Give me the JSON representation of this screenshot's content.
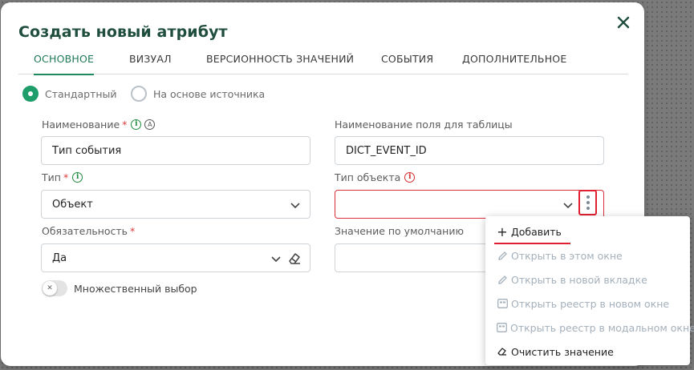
{
  "dialog": {
    "title": "Создать новый атрибут",
    "close_icon": "close-icon"
  },
  "tabs": [
    {
      "label": "ОСНОВНОЕ",
      "active": true
    },
    {
      "label": "ВИЗУАЛ",
      "active": false
    },
    {
      "label": "ВЕРСИОННОСТЬ ЗНАЧЕНИЙ",
      "active": false
    },
    {
      "label": "СОБЫТИЯ",
      "active": false
    },
    {
      "label": "ДОПОЛНИТЕЛЬНОЕ",
      "active": false
    }
  ],
  "source_mode": {
    "options": [
      {
        "label": "Стандартный",
        "checked": true
      },
      {
        "label": "На основе источника",
        "checked": false
      }
    ]
  },
  "fields": {
    "name": {
      "label": "Наименование",
      "required": "*",
      "info": "i",
      "lang_badge": "A",
      "value": "Тип события"
    },
    "table_field": {
      "label": "Наименование поля для таблицы",
      "value": "DICT_EVENT_ID"
    },
    "type": {
      "label": "Тип",
      "required": "*",
      "info": "i",
      "value": "Объект"
    },
    "object_type": {
      "label": "Тип объекта",
      "info": "i",
      "value": ""
    },
    "mandatory": {
      "label": "Обязательность",
      "required": "*",
      "value": "Да"
    },
    "default_value": {
      "label": "Значение по умолчанию",
      "value": ""
    }
  },
  "multi_select": {
    "label": "Множественный выбор",
    "enabled": false,
    "knob_glyph": "✕"
  },
  "context_menu": {
    "items": [
      {
        "label": "Добавить",
        "icon": "plus-icon",
        "glyph": "+",
        "enabled": true
      },
      {
        "label": "Открыть в этом окне",
        "icon": "pencil-icon",
        "enabled": false
      },
      {
        "label": "Открыть в новой вкладке",
        "icon": "pencil-icon",
        "enabled": false
      },
      {
        "label": "Открыть реестр в новом окне",
        "icon": "registry-icon",
        "enabled": false
      },
      {
        "label": "Открыть реестр в модальном окне",
        "icon": "registry-icon",
        "enabled": false
      },
      {
        "label": "Очистить значение",
        "icon": "eraser-icon",
        "enabled": true
      }
    ]
  },
  "colors": {
    "accent": "#1f8a5e",
    "title": "#1f4e3d",
    "error": "#e02030",
    "disabled_text": "#a4b0bb"
  }
}
